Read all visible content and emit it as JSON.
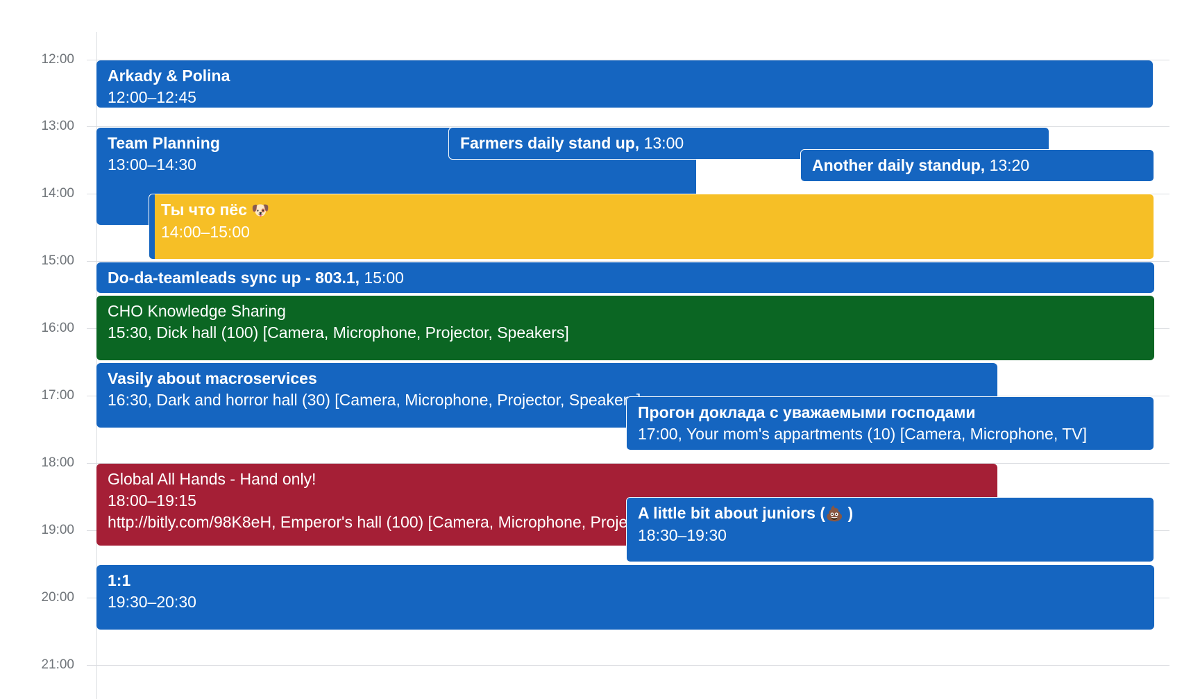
{
  "hours": [
    "12:00",
    "13:00",
    "14:00",
    "15:00",
    "16:00",
    "17:00",
    "18:00",
    "19:00",
    "20:00",
    "21:00"
  ],
  "events": {
    "arkady": {
      "title": "Arkady & Polina",
      "time": "12:00–12:45",
      "color": "#1565c0"
    },
    "team_planning": {
      "title": "Team Planning",
      "time": "13:00–14:30",
      "color": "#1565c0"
    },
    "farmers": {
      "title": "Farmers daily stand up,",
      "time": " 13:00",
      "color": "#1565c0"
    },
    "another": {
      "title": "Another daily standup,",
      "time": " 13:20",
      "color": "#1565c0"
    },
    "pes": {
      "title": "Ты что пёс",
      "emoji": "🐶",
      "time": "14:00–15:00",
      "color": "#f6bf26"
    },
    "doda": {
      "title": "Do-da-teamleads sync up - 803.1,",
      "time": " 15:00",
      "color": "#1565c0"
    },
    "cho": {
      "title": "CHO Knowledge Sharing",
      "details": "15:30, Dick hall (100) [Camera, Microphone, Projector, Speakers]",
      "color": "#0b6623"
    },
    "vasily": {
      "title": "Vasily about macroservices",
      "details": "16:30, Dark and horror hall (30) [Camera, Microphone, Projector, Speakers]",
      "color": "#1565c0"
    },
    "progon": {
      "title": "Прогон доклада с уважаемыми господами",
      "details": "17:00, Your mom's appartments (10) [Camera, Microphone, TV]",
      "color": "#1565c0"
    },
    "global": {
      "title": "Global All Hands - Hand only!",
      "time": "18:00–19:15",
      "details": "http://bitly.com/98K8eH, Emperor's hall (100) [Camera, Microphone, Projector, Speakers]",
      "color": "#a51f36"
    },
    "juniors": {
      "title": "A little bit about juniors (",
      "emoji": "💩",
      "title_end": " )",
      "time": "18:30–19:30",
      "color": "#1565c0"
    },
    "one_one": {
      "title": "1:1",
      "time": "19:30–20:30",
      "color": "#1565c0"
    }
  }
}
